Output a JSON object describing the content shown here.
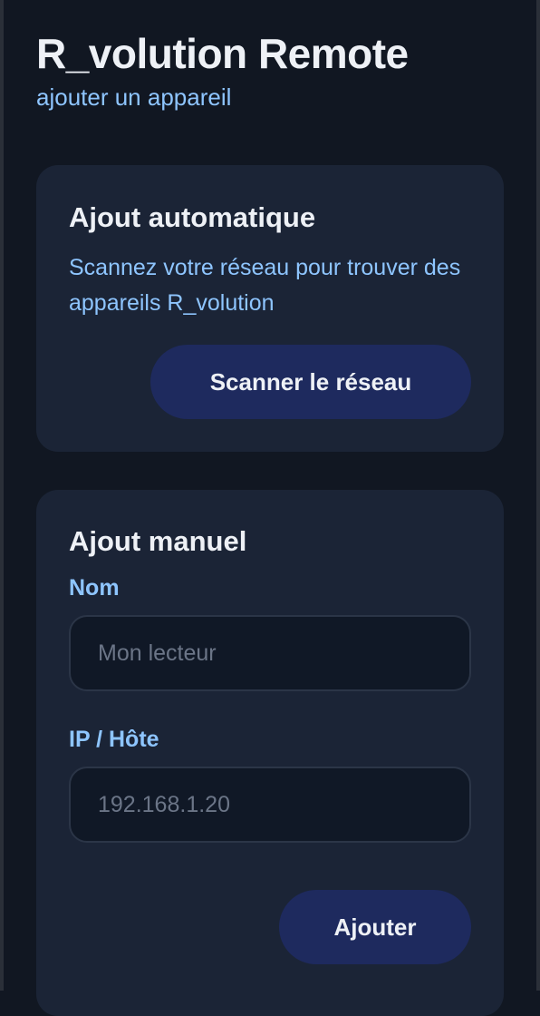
{
  "app": {
    "title": "R_volution Remote",
    "subtitle": "ajouter un appareil"
  },
  "auto_add": {
    "title": "Ajout automatique",
    "description": "Scannez votre réseau pour trouver des appareils R_volution",
    "scan_button_label": "Scanner le réseau"
  },
  "manual_add": {
    "title": "Ajout manuel",
    "name_label": "Nom",
    "name_placeholder": "Mon lecteur",
    "name_value": "",
    "host_label": "IP / Hôte",
    "host_placeholder": "192.168.1.20",
    "host_value": "",
    "add_button_label": "Ajouter"
  },
  "colors": {
    "background": "#111722",
    "card": "#1b2436",
    "accent_text": "#8ec5ff",
    "button": "#1e2a5e",
    "input": "#101826"
  }
}
